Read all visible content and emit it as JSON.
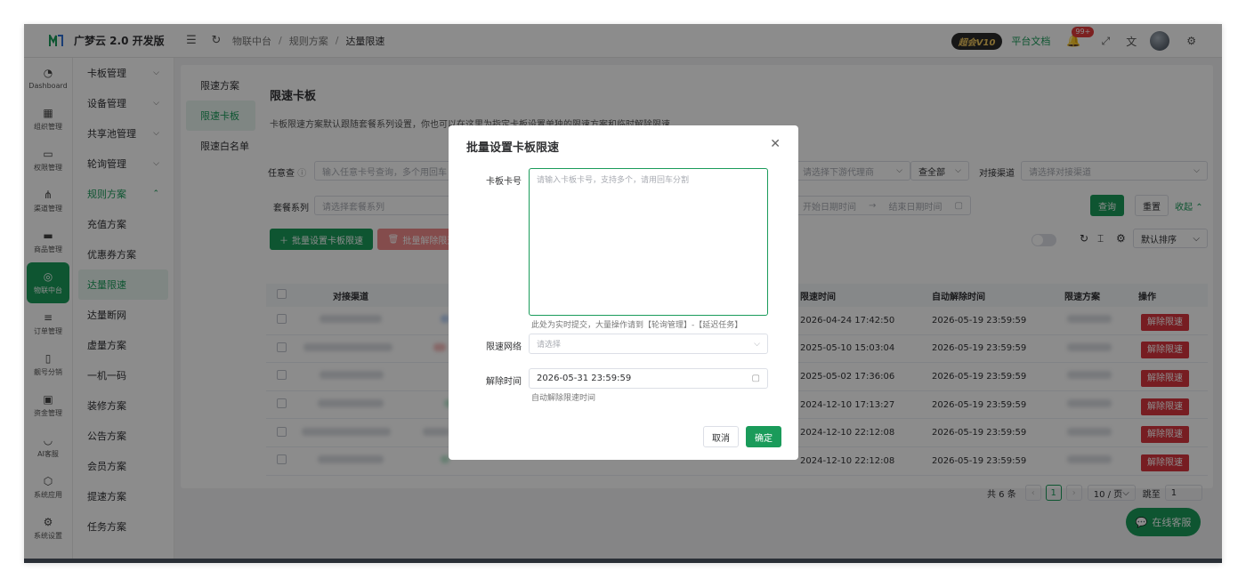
{
  "header": {
    "app_name": "广梦云 2.0 开发版",
    "breadcrumb": [
      "物联中台",
      "规则方案",
      "达量限速"
    ],
    "vip_badge": "超会V10",
    "doc_link": "平台文档",
    "notif_count": "99+"
  },
  "rail": [
    {
      "label": "Dashboard",
      "icon": "◔"
    },
    {
      "label": "组织管理",
      "icon": "▦"
    },
    {
      "label": "权限管理",
      "icon": "▭"
    },
    {
      "label": "渠道管理",
      "icon": "⋔"
    },
    {
      "label": "商品管理",
      "icon": "▬"
    },
    {
      "label": "物联中台",
      "icon": "◎"
    },
    {
      "label": "订单管理",
      "icon": "≡"
    },
    {
      "label": "靓号分销",
      "icon": "▯"
    },
    {
      "label": "资金管理",
      "icon": "▣"
    },
    {
      "label": "AI客服",
      "icon": "◡"
    },
    {
      "label": "系统应用",
      "icon": "⬡"
    },
    {
      "label": "系统设置",
      "icon": "⚙"
    }
  ],
  "subnav": [
    {
      "label": "卡板管理",
      "chev": "⌵"
    },
    {
      "label": "设备管理",
      "chev": "⌵"
    },
    {
      "label": "共享池管理",
      "chev": "⌵"
    },
    {
      "label": "轮询管理",
      "chev": "⌵"
    },
    {
      "label": "规则方案",
      "chev": "⌃"
    },
    {
      "label": "充值方案"
    },
    {
      "label": "优惠券方案"
    },
    {
      "label": "达量限速"
    },
    {
      "label": "达量断网"
    },
    {
      "label": "虚量方案"
    },
    {
      "label": "一机一码"
    },
    {
      "label": "装修方案"
    },
    {
      "label": "公告方案"
    },
    {
      "label": "会员方案"
    },
    {
      "label": "提速方案"
    },
    {
      "label": "任务方案"
    }
  ],
  "tabs": [
    "限速方案",
    "限速卡板",
    "限速白名单"
  ],
  "page": {
    "title": "限速卡板",
    "desc": "卡板限速方案默认跟随套餐系列设置，你也可以在这里为指定卡板设置单独的限速方案和临时解除限速"
  },
  "filters": {
    "any_label": "任意查",
    "any_placeholder": "输入任意卡号查询，多个用回车",
    "downstream_placeholder": "请选择下游代理商",
    "scope_value": "查全部",
    "channel_label": "对接渠道",
    "channel_placeholder": "请选择对接渠道",
    "series_label": "套餐系列",
    "series_placeholder": "请选择套餐系列",
    "start_date": "开始日期时间",
    "end_date": "结束日期时间",
    "query": "查询",
    "reset": "重置",
    "collapse": "收起"
  },
  "actions": {
    "batch_set": "批量设置卡板限速",
    "batch_remove": "批量解除限速",
    "sort": "默认排序"
  },
  "table": {
    "headers": {
      "channel": "对接渠道",
      "limit_time": "限速时间",
      "auto_release": "自动解除时间",
      "plan": "限速方案",
      "op": "操作"
    },
    "rows": [
      {
        "limit_time": "2026-04-24 17:42:50",
        "auto_release": "2026-05-19 23:59:59",
        "op": "解除限速"
      },
      {
        "limit_time": "2025-05-10 15:03:04",
        "auto_release": "2026-05-19 23:59:59",
        "op": "解除限速"
      },
      {
        "limit_time": "2025-05-02 17:36:06",
        "auto_release": "2026-05-19 23:59:59",
        "op": "解除限速"
      },
      {
        "limit_time": "2024-12-10 17:13:27",
        "auto_release": "2026-05-19 23:59:59",
        "op": "解除限速"
      },
      {
        "limit_time": "2024-12-10 22:12:08",
        "auto_release": "2026-05-19 23:59:59",
        "op": "解除限速"
      },
      {
        "limit_time": "2024-12-10 22:12:08",
        "auto_release": "2026-05-19 23:59:59",
        "op": "解除限速"
      }
    ]
  },
  "pager": {
    "total": "共 6 条",
    "current": "1",
    "page_size": "10 / 页",
    "goto_label": "跳至",
    "goto_value": "1"
  },
  "dialog": {
    "title": "批量设置卡板限速",
    "card_label": "卡板卡号",
    "card_placeholder": "请输入卡板卡号，支持多个，请用回车分割",
    "card_hint": "此处为实时提交，大量操作请到【轮询管理】-【延迟任务】",
    "network_label": "限速网络",
    "network_placeholder": "请选择",
    "release_label": "解除时间",
    "release_value": "2026-05-31 23:59:59",
    "release_hint": "自动解除限速时间",
    "cancel": "取消",
    "confirm": "确定"
  },
  "chat": {
    "label": "在线客服"
  },
  "colors": {
    "accent": "#1a9b5a",
    "danger": "#d9363e"
  }
}
